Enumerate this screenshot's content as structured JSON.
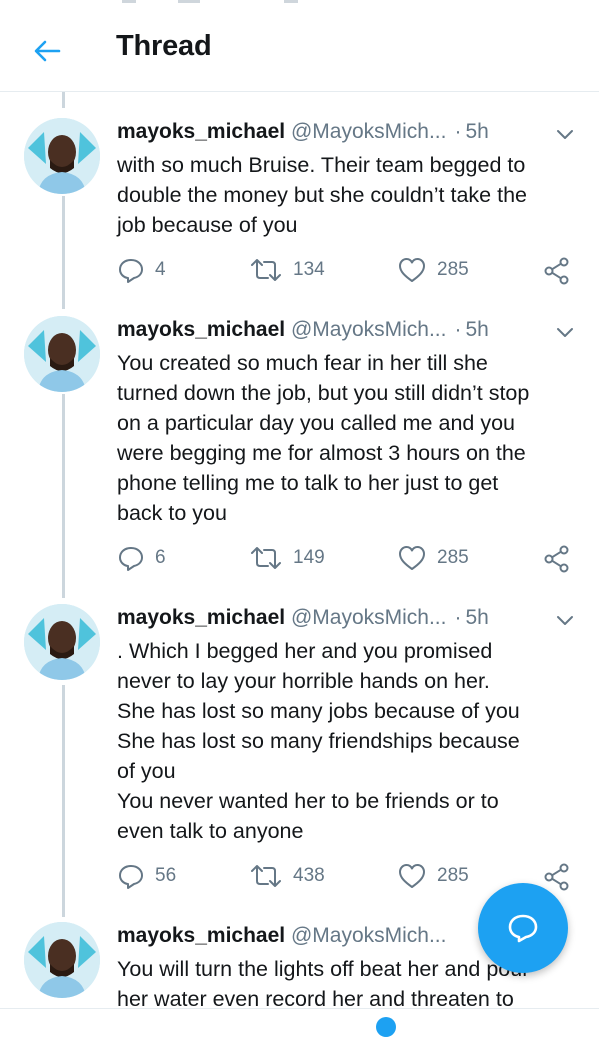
{
  "header": {
    "title": "Thread"
  },
  "colors": {
    "accent": "#1da1f2",
    "secondary_text": "#657786",
    "divider": "#e6ecf0"
  },
  "tweets": [
    {
      "name": "mayoks_michael",
      "handle": "@MayoksMich...",
      "separator": "·",
      "time": "5h",
      "lines": [
        "with so much Bruise. Their team begged to",
        "double the money but she couldn’t take the",
        "job because of you"
      ],
      "replies": "4",
      "retweets": "134",
      "likes": "285"
    },
    {
      "name": "mayoks_michael",
      "handle": "@MayoksMich...",
      "separator": "·",
      "time": "5h",
      "lines": [
        "You created so much fear in her till she",
        "turned down the job, but you still didn’t stop",
        "on a particular day you called me and you",
        "were begging me for almost 3 hours on the",
        "phone telling me to talk to her just to get",
        "back to you"
      ],
      "replies": "6",
      "retweets": "149",
      "likes": "285"
    },
    {
      "name": "mayoks_michael",
      "handle": "@MayoksMich...",
      "separator": "·",
      "time": "5h",
      "lines": [
        ". Which I begged her and you promised",
        "never to lay your horrible hands on her.",
        "She has lost so many jobs because of you",
        "She has lost so many friendships because",
        "of you",
        "You never wanted her to be friends or to",
        "even talk to anyone"
      ],
      "replies": "56",
      "retweets": "438",
      "likes": "285"
    },
    {
      "name": "mayoks_michael",
      "handle": "@MayoksMich...",
      "lines": [
        "You will turn the lights off beat her and pour",
        "her water even record her and threaten to"
      ]
    }
  ]
}
